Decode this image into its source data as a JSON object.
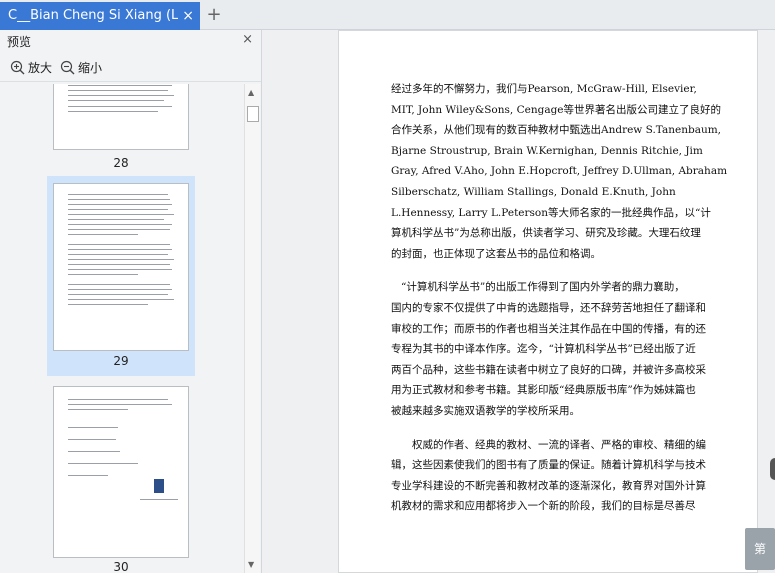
{
  "tab": {
    "title": "C__Bian Cheng Si Xiang (Liang",
    "close": "×",
    "new_tab": "+"
  },
  "sidebar": {
    "title": "预览",
    "close": "×",
    "zoom_in": "放大",
    "zoom_out": "缩小",
    "pages": [
      {
        "number": "28"
      },
      {
        "number": "29"
      },
      {
        "number": "30"
      }
    ]
  },
  "document": {
    "lines_p1": [
      "经过多年的不懈努力，我们与Pearson, McGraw-Hill, Elsevier,",
      "MIT, John Wiley&Sons, Cengage等世界著名出版公司建立了良好的",
      "合作关系，从他们现有的数百种教材中甄选出Andrew S.Tanenbaum,",
      "Bjarne Stroustrup, Brain W.Kernighan, Dennis Ritchie, Jim",
      "Gray, Afred V.Aho, John E.Hopcroft, Jeffrey D.Ullman, Abraham",
      "Silberschatz, William Stallings, Donald E.Knuth, John",
      "L.Hennessy, Larry L.Peterson等大师名家的一批经典作品，以“计",
      "算机科学丛书”为总称出版，供读者学习、研究及珍藏。大理石纹理",
      "的封面，也正体现了这套丛书的品位和格调。"
    ],
    "lines_p2": [
      "“计算机科学丛书”的出版工作得到了国内外学者的鼎力襄助，",
      "国内的专家不仅提供了中肯的选题指导，还不辞劳苦地担任了翻译和",
      "审校的工作；而原书的作者也相当关注其作品在中国的传播，有的还",
      "专程为其书的中译本作序。迄今，“计算机科学丛书”已经出版了近",
      "两百个品种，这些书籍在读者中树立了良好的口碑，并被许多高校采",
      "用为正式教材和参考书籍。其影印版“经典原版书库”作为姊妹篇也",
      "被越来越多实施双语教学的学校所采用。"
    ],
    "lines_p3": [
      "权威的作者、经典的教材、一流的译者、严格的审校、精细的编",
      "辑，这些因素使我们的图书有了质量的保证。随着计算机科学与技术",
      "专业学科建设的不断完善和教材改革的逐渐深化，教育界对国外计算",
      "机教材的需求和应用都将步入一个新的阶段，我们的目标是尽善尽"
    ]
  },
  "next_page_button": "第"
}
